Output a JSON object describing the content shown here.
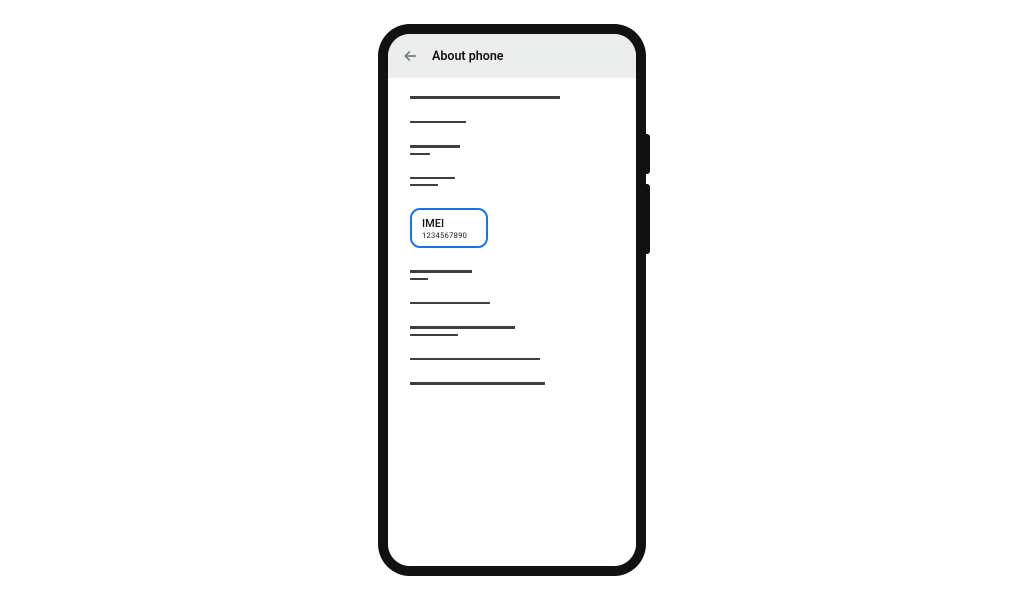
{
  "header": {
    "title": "About phone"
  },
  "highlight": {
    "label": "IMEI",
    "value": "1234567890"
  }
}
